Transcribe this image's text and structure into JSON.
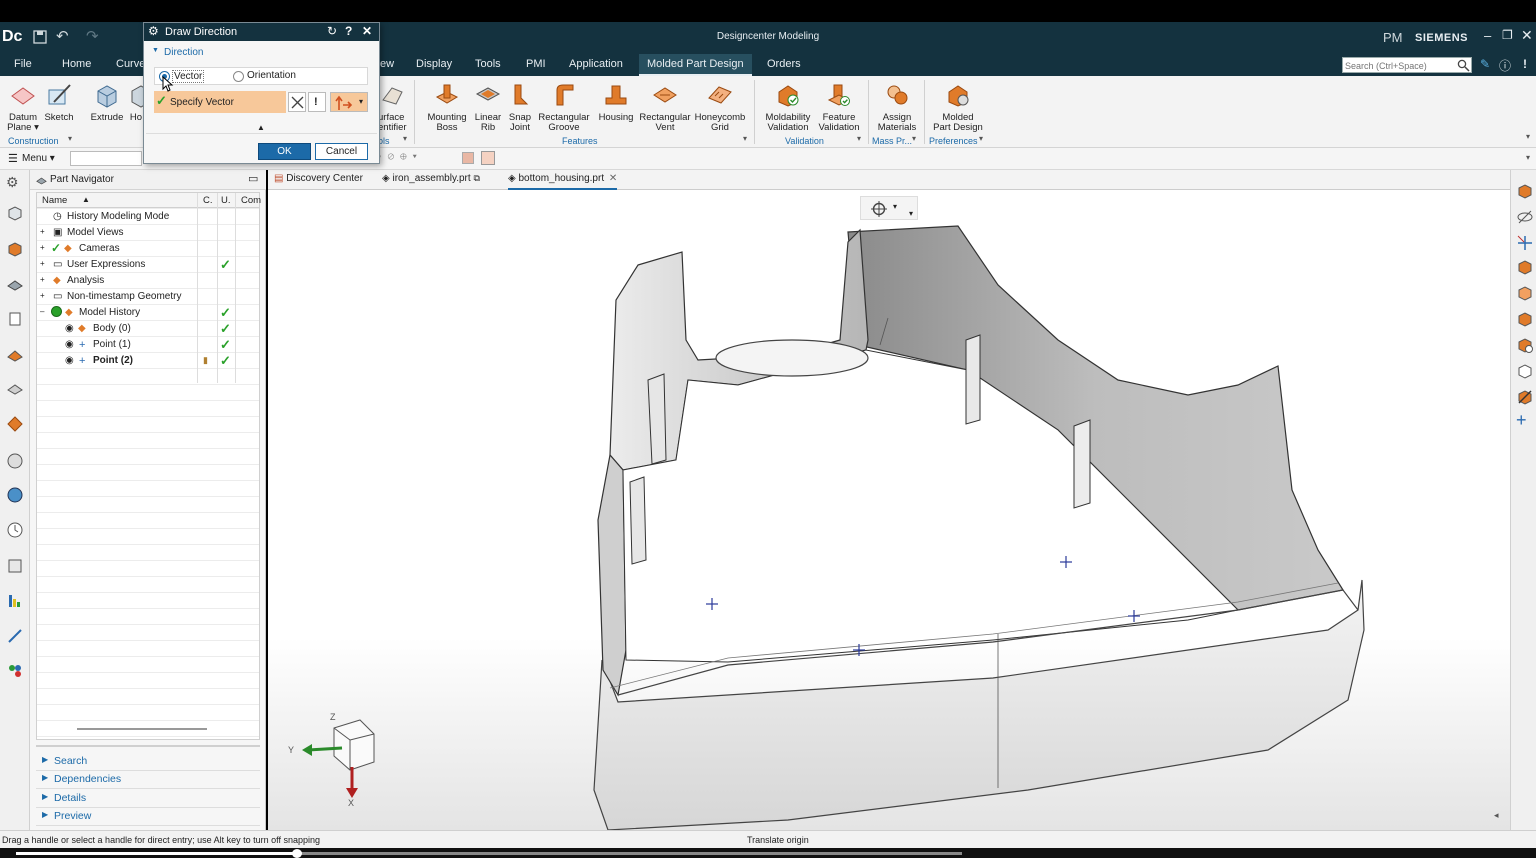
{
  "app": {
    "logo": "Dc",
    "title": "Designcenter Modeling",
    "user_initials": "PM",
    "brand": "SIEMENS",
    "search_placeholder": "Search (Ctrl+Space)"
  },
  "menu": [
    "File",
    "Home",
    "Curve",
    "ew",
    "Display",
    "Tools",
    "PMI",
    "Application",
    "Molded Part Design",
    "Orders"
  ],
  "ribbon": {
    "left": [
      {
        "l1": "Datum",
        "l2": "Plane ▾"
      },
      {
        "l1": "Sketch",
        "l2": ""
      },
      {
        "l1": "Extrude",
        "l2": ""
      },
      {
        "l1": "Ho",
        "l2": ""
      }
    ],
    "left_group": "Construction",
    "partial": {
      "l1": "urface",
      "l2": "entifier",
      "group": "ols"
    },
    "features": [
      {
        "l1": "Mounting",
        "l2": "Boss"
      },
      {
        "l1": "Linear",
        "l2": "Rib"
      },
      {
        "l1": "Snap",
        "l2": "Joint"
      },
      {
        "l1": "Rectangular",
        "l2": "Groove"
      },
      {
        "l1": "Housing",
        "l2": ""
      },
      {
        "l1": "Rectangular",
        "l2": "Vent"
      },
      {
        "l1": "Honeycomb",
        "l2": "Grid"
      }
    ],
    "features_group": "Features",
    "validation": [
      {
        "l1": "Moldability",
        "l2": "Validation"
      },
      {
        "l1": "Feature",
        "l2": "Validation"
      }
    ],
    "validation_group": "Validation",
    "mass": {
      "l1": "Assign",
      "l2": "Materials"
    },
    "mass_group": "Mass Pr...",
    "pref": {
      "l1": "Molded",
      "l2": "Part Design"
    },
    "pref_group": "Preferences"
  },
  "qbar": {
    "menu_label": "Menu ▾"
  },
  "dialog": {
    "title": "Draw Direction",
    "section": "Direction",
    "option_vector": "Vector",
    "option_orientation": "Orientation",
    "specify_vector": "Specify Vector",
    "ok": "OK",
    "cancel": "Cancel"
  },
  "navigator": {
    "title": "Part Navigator",
    "columns": [
      "Name",
      "C.",
      "U.",
      "Com"
    ],
    "rows": [
      {
        "label": "History Modeling Mode",
        "indent": 0,
        "check": false,
        "bold": false
      },
      {
        "label": "Model Views",
        "indent": 0,
        "check": false,
        "bold": false
      },
      {
        "label": "Cameras",
        "indent": 0,
        "check": false,
        "bold": false
      },
      {
        "label": "User Expressions",
        "indent": 0,
        "check": true,
        "bold": false
      },
      {
        "label": "Analysis",
        "indent": 0,
        "check": false,
        "bold": false
      },
      {
        "label": "Non-timestamp Geometry",
        "indent": 0,
        "check": false,
        "bold": false
      },
      {
        "label": "Model History",
        "indent": 0,
        "check": true,
        "bold": false
      },
      {
        "label": "Body (0)",
        "indent": 1,
        "check": true,
        "bold": false
      },
      {
        "label": "Point (1)",
        "indent": 1,
        "check": true,
        "bold": false
      },
      {
        "label": "Point (2)",
        "indent": 1,
        "check": true,
        "bold": true
      }
    ],
    "sections": [
      "Search",
      "Dependencies",
      "Details",
      "Preview"
    ]
  },
  "tabs": [
    "Discovery Center",
    "iron_assembly.prt",
    "bottom_housing.prt"
  ],
  "triad": {
    "y": "Y",
    "z": "Z",
    "x": "X"
  },
  "status": {
    "left": "Drag a handle or select a handle for direct entry; use Alt key to turn off snapping",
    "center": "Translate origin"
  },
  "colors": {
    "titlebar": "#14323f",
    "accent": "#1c6aa8",
    "ribbon_icon": "#e07b2a",
    "highlight": "#f7c89a",
    "ok_button": "#1c6aa8"
  }
}
